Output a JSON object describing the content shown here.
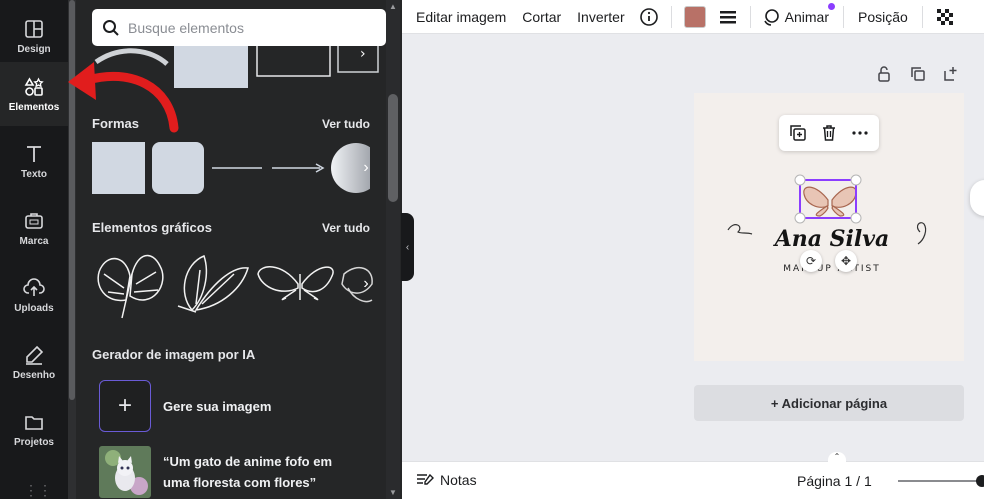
{
  "rail": {
    "items": [
      {
        "label": "Design",
        "icon": "design-icon"
      },
      {
        "label": "Elementos",
        "icon": "elements-icon"
      },
      {
        "label": "Texto",
        "icon": "text-icon"
      },
      {
        "label": "Marca",
        "icon": "brand-icon"
      },
      {
        "label": "Uploads",
        "icon": "upload-icon"
      },
      {
        "label": "Desenho",
        "icon": "draw-icon"
      },
      {
        "label": "Projetos",
        "icon": "folder-icon"
      }
    ]
  },
  "panel": {
    "search_placeholder": "Busque elementos",
    "sections": {
      "shapes_title": "Formas",
      "graphics_title": "Elementos gráficos",
      "ai_title": "Gerador de imagem por IA",
      "see_all": "Ver tudo"
    },
    "ai": {
      "generate_label": "Gere sua imagem",
      "prompt_line1": "“Um gato de anime fofo em",
      "prompt_line2": "uma floresta com flores”"
    }
  },
  "toolbar": {
    "edit_image": "Editar imagem",
    "crop": "Cortar",
    "flip": "Inverter",
    "animate": "Animar",
    "position": "Posição",
    "color_swatch": "#b87167"
  },
  "canvas": {
    "logo_name": "Ana Silva",
    "logo_subtitle": "MAKEUP ARTIST",
    "add_page": "+ Adicionar página"
  },
  "bottom": {
    "notes": "Notas",
    "page_indicator": "Página 1 / 1"
  },
  "colors": {
    "accent": "#8b3dff",
    "arrow": "#e11d1d"
  }
}
